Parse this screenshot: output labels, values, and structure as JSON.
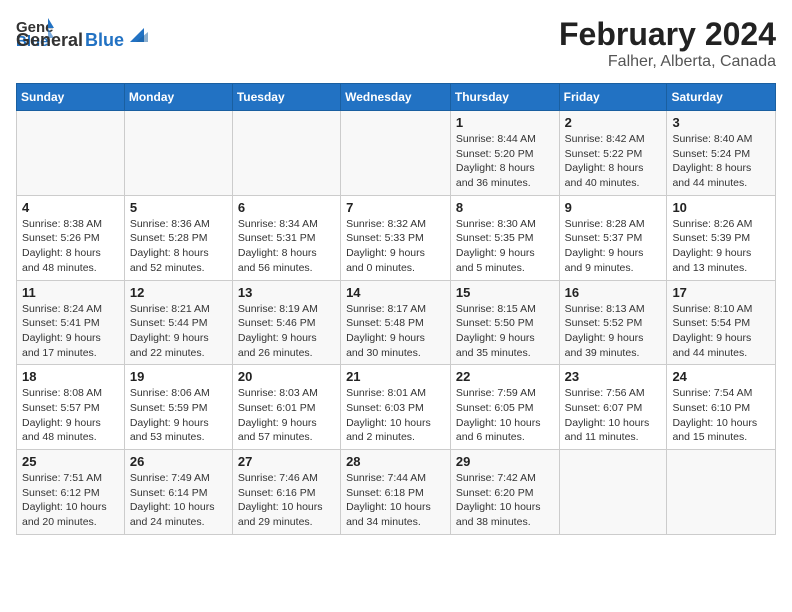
{
  "logo": {
    "text_general": "General",
    "text_blue": "Blue"
  },
  "title": "February 2024",
  "subtitle": "Falher, Alberta, Canada",
  "days_of_week": [
    "Sunday",
    "Monday",
    "Tuesday",
    "Wednesday",
    "Thursday",
    "Friday",
    "Saturday"
  ],
  "weeks": [
    [
      {
        "day": "",
        "info": ""
      },
      {
        "day": "",
        "info": ""
      },
      {
        "day": "",
        "info": ""
      },
      {
        "day": "",
        "info": ""
      },
      {
        "day": "1",
        "info": "Sunrise: 8:44 AM\nSunset: 5:20 PM\nDaylight: 8 hours and 36 minutes."
      },
      {
        "day": "2",
        "info": "Sunrise: 8:42 AM\nSunset: 5:22 PM\nDaylight: 8 hours and 40 minutes."
      },
      {
        "day": "3",
        "info": "Sunrise: 8:40 AM\nSunset: 5:24 PM\nDaylight: 8 hours and 44 minutes."
      }
    ],
    [
      {
        "day": "4",
        "info": "Sunrise: 8:38 AM\nSunset: 5:26 PM\nDaylight: 8 hours and 48 minutes."
      },
      {
        "day": "5",
        "info": "Sunrise: 8:36 AM\nSunset: 5:28 PM\nDaylight: 8 hours and 52 minutes."
      },
      {
        "day": "6",
        "info": "Sunrise: 8:34 AM\nSunset: 5:31 PM\nDaylight: 8 hours and 56 minutes."
      },
      {
        "day": "7",
        "info": "Sunrise: 8:32 AM\nSunset: 5:33 PM\nDaylight: 9 hours and 0 minutes."
      },
      {
        "day": "8",
        "info": "Sunrise: 8:30 AM\nSunset: 5:35 PM\nDaylight: 9 hours and 5 minutes."
      },
      {
        "day": "9",
        "info": "Sunrise: 8:28 AM\nSunset: 5:37 PM\nDaylight: 9 hours and 9 minutes."
      },
      {
        "day": "10",
        "info": "Sunrise: 8:26 AM\nSunset: 5:39 PM\nDaylight: 9 hours and 13 minutes."
      }
    ],
    [
      {
        "day": "11",
        "info": "Sunrise: 8:24 AM\nSunset: 5:41 PM\nDaylight: 9 hours and 17 minutes."
      },
      {
        "day": "12",
        "info": "Sunrise: 8:21 AM\nSunset: 5:44 PM\nDaylight: 9 hours and 22 minutes."
      },
      {
        "day": "13",
        "info": "Sunrise: 8:19 AM\nSunset: 5:46 PM\nDaylight: 9 hours and 26 minutes."
      },
      {
        "day": "14",
        "info": "Sunrise: 8:17 AM\nSunset: 5:48 PM\nDaylight: 9 hours and 30 minutes."
      },
      {
        "day": "15",
        "info": "Sunrise: 8:15 AM\nSunset: 5:50 PM\nDaylight: 9 hours and 35 minutes."
      },
      {
        "day": "16",
        "info": "Sunrise: 8:13 AM\nSunset: 5:52 PM\nDaylight: 9 hours and 39 minutes."
      },
      {
        "day": "17",
        "info": "Sunrise: 8:10 AM\nSunset: 5:54 PM\nDaylight: 9 hours and 44 minutes."
      }
    ],
    [
      {
        "day": "18",
        "info": "Sunrise: 8:08 AM\nSunset: 5:57 PM\nDaylight: 9 hours and 48 minutes."
      },
      {
        "day": "19",
        "info": "Sunrise: 8:06 AM\nSunset: 5:59 PM\nDaylight: 9 hours and 53 minutes."
      },
      {
        "day": "20",
        "info": "Sunrise: 8:03 AM\nSunset: 6:01 PM\nDaylight: 9 hours and 57 minutes."
      },
      {
        "day": "21",
        "info": "Sunrise: 8:01 AM\nSunset: 6:03 PM\nDaylight: 10 hours and 2 minutes."
      },
      {
        "day": "22",
        "info": "Sunrise: 7:59 AM\nSunset: 6:05 PM\nDaylight: 10 hours and 6 minutes."
      },
      {
        "day": "23",
        "info": "Sunrise: 7:56 AM\nSunset: 6:07 PM\nDaylight: 10 hours and 11 minutes."
      },
      {
        "day": "24",
        "info": "Sunrise: 7:54 AM\nSunset: 6:10 PM\nDaylight: 10 hours and 15 minutes."
      }
    ],
    [
      {
        "day": "25",
        "info": "Sunrise: 7:51 AM\nSunset: 6:12 PM\nDaylight: 10 hours and 20 minutes."
      },
      {
        "day": "26",
        "info": "Sunrise: 7:49 AM\nSunset: 6:14 PM\nDaylight: 10 hours and 24 minutes."
      },
      {
        "day": "27",
        "info": "Sunrise: 7:46 AM\nSunset: 6:16 PM\nDaylight: 10 hours and 29 minutes."
      },
      {
        "day": "28",
        "info": "Sunrise: 7:44 AM\nSunset: 6:18 PM\nDaylight: 10 hours and 34 minutes."
      },
      {
        "day": "29",
        "info": "Sunrise: 7:42 AM\nSunset: 6:20 PM\nDaylight: 10 hours and 38 minutes."
      },
      {
        "day": "",
        "info": ""
      },
      {
        "day": "",
        "info": ""
      }
    ]
  ]
}
